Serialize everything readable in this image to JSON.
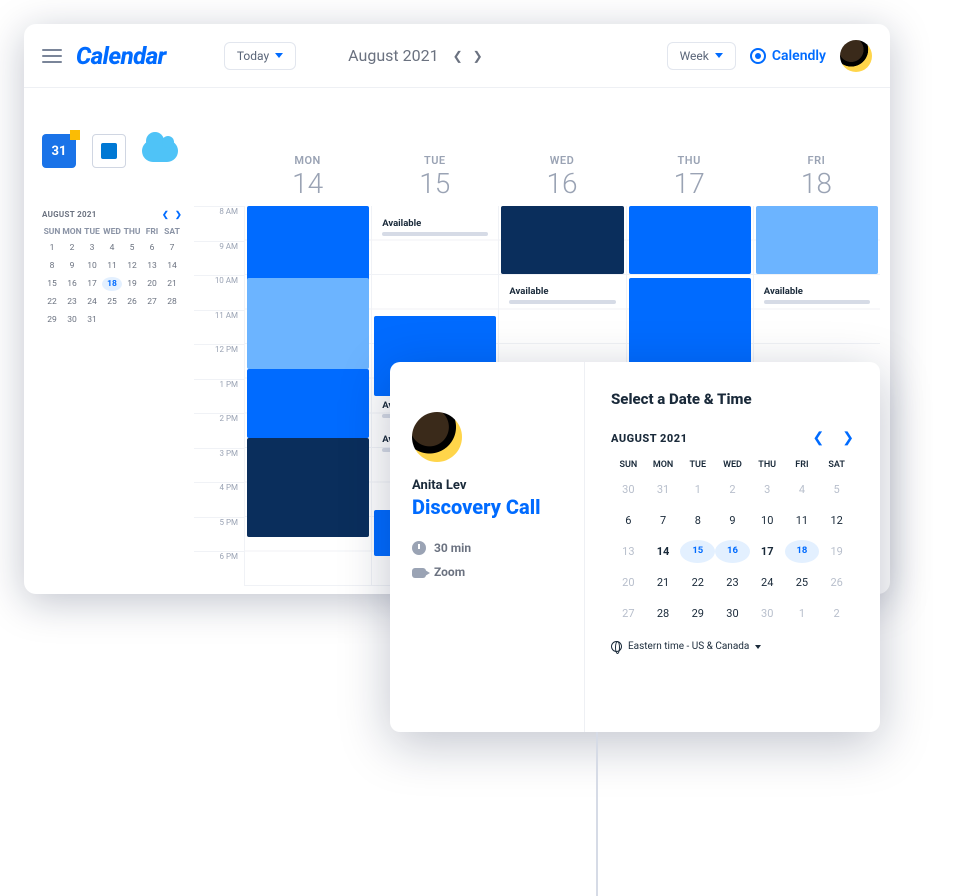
{
  "header": {
    "brand": "Calendar",
    "today_label": "Today",
    "month_label": "August 2021",
    "view_label": "Week",
    "integration_label": "Calendly"
  },
  "mini": {
    "title": "AUGUST 2021",
    "dow": [
      "SUN",
      "MON",
      "TUE",
      "WED",
      "THU",
      "FRI",
      "SAT"
    ],
    "days": [
      "1",
      "2",
      "3",
      "4",
      "5",
      "6",
      "7",
      "8",
      "9",
      "10",
      "11",
      "12",
      "13",
      "14",
      "15",
      "16",
      "17",
      "18",
      "19",
      "20",
      "21",
      "22",
      "23",
      "24",
      "25",
      "26",
      "27",
      "28",
      "29",
      "30",
      "31"
    ],
    "today": "18"
  },
  "week": {
    "day_labels": [
      "MON",
      "TUE",
      "WED",
      "THU",
      "FRI"
    ],
    "day_nums": [
      "14",
      "15",
      "16",
      "17",
      "18"
    ],
    "hours": [
      "8 AM",
      "9 AM",
      "10 AM",
      "11 AM",
      "12 PM",
      "1 PM",
      "2 PM",
      "3 PM",
      "4 PM",
      "5 PM",
      "6 PM"
    ],
    "available_label": "Available"
  },
  "booking": {
    "host_name": "Anita Lev",
    "event_title": "Discovery Call",
    "duration": "30 min",
    "location": "Zoom",
    "heading": "Select a Date & Time",
    "month": "AUGUST 2021",
    "dow": [
      "SUN",
      "MON",
      "TUE",
      "WED",
      "THU",
      "FRI",
      "SAT"
    ],
    "grid": [
      [
        "30",
        "31",
        "1",
        "2",
        "3",
        "4",
        "5"
      ],
      [
        "6",
        "7",
        "8",
        "9",
        "10",
        "11",
        "12"
      ],
      [
        "13",
        "14",
        "15",
        "16",
        "17",
        "18",
        "19"
      ],
      [
        "20",
        "21",
        "22",
        "23",
        "24",
        "25",
        "26"
      ],
      [
        "27",
        "28",
        "29",
        "30",
        "30",
        "1",
        "2"
      ]
    ],
    "muted": [
      "30",
      "31",
      "1",
      "2",
      "3",
      "4",
      "5",
      "13",
      "19",
      "20",
      "26",
      "27"
    ],
    "available_dates": [
      "15",
      "16",
      "18"
    ],
    "bold_dates": [
      "14",
      "17"
    ],
    "timezone": "Eastern time - US & Canada"
  }
}
